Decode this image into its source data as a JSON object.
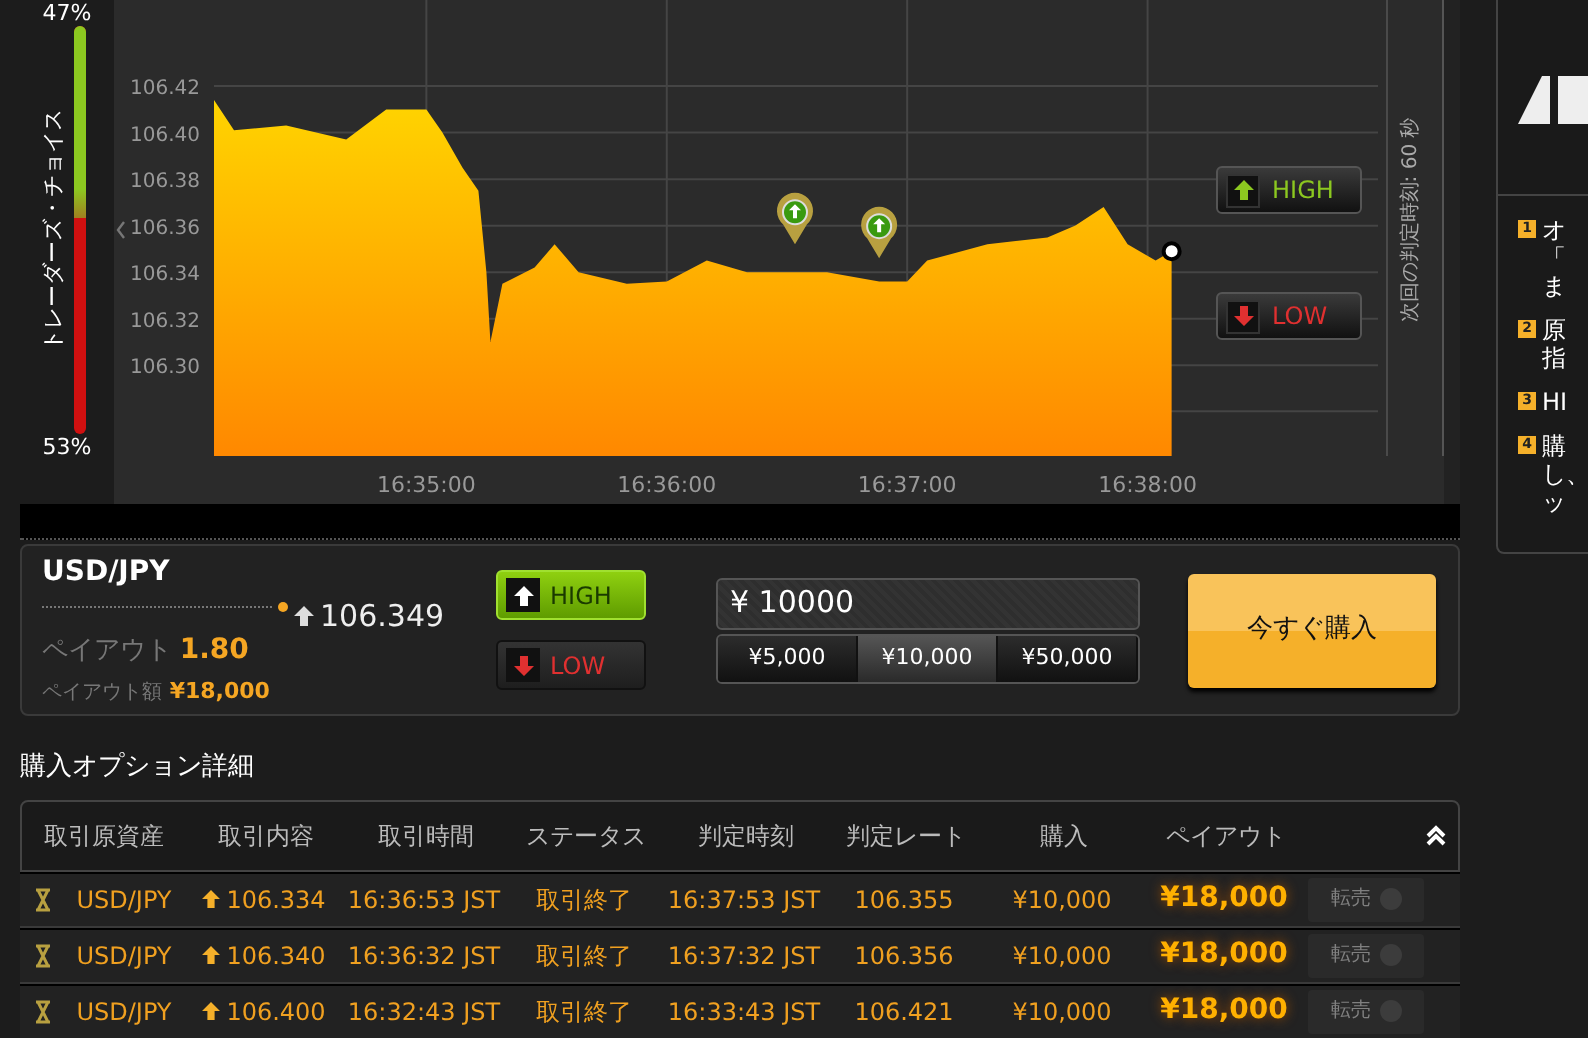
{
  "sentiment": {
    "top_pct": "47%",
    "bottom_pct": "53%",
    "label": "トレーダーズ・チョイス",
    "level": 0.47
  },
  "chart": {
    "next_expiry": "次回の判定時刻: 60 秒",
    "buttons": [
      {
        "label": "HIGH",
        "kind": "high"
      },
      {
        "label": "LOW",
        "kind": "low"
      }
    ],
    "chart_data": {
      "type": "area",
      "grid": true,
      "xlim": [
        59647,
        59939
      ],
      "ylim": [
        106.261,
        106.457
      ],
      "xticks": [
        {
          "value": 59700,
          "label": "16:35:00"
        },
        {
          "value": 59760,
          "label": "16:36:00"
        },
        {
          "value": 59820,
          "label": "16:37:00"
        },
        {
          "value": 59880,
          "label": "16:38:00"
        }
      ],
      "yticks": [
        {
          "value": 106.3,
          "label": "106.30"
        },
        {
          "value": 106.32,
          "label": "106.32"
        },
        {
          "value": 106.34,
          "label": "106.34"
        },
        {
          "value": 106.36,
          "label": "106.36"
        },
        {
          "value": 106.38,
          "label": "106.38"
        },
        {
          "value": 106.4,
          "label": "106.40"
        },
        {
          "value": 106.42,
          "label": "106.42"
        }
      ],
      "x": [
        59647,
        59652,
        59665,
        59680,
        59690,
        59700,
        59704,
        59709,
        59713,
        59715,
        59716,
        59719,
        59727,
        59732,
        59738,
        59750,
        59760,
        59770,
        59780,
        59792,
        59800,
        59813,
        59820,
        59825,
        59840,
        59855,
        59862,
        59869,
        59875,
        59882,
        59886
      ],
      "values": [
        106.414,
        106.401,
        106.403,
        106.397,
        106.41,
        106.41,
        106.4,
        106.385,
        106.375,
        106.34,
        106.31,
        106.335,
        106.342,
        106.352,
        106.34,
        106.335,
        106.336,
        106.345,
        106.34,
        106.34,
        106.34,
        106.336,
        106.336,
        106.345,
        106.352,
        106.355,
        106.36,
        106.368,
        106.352,
        106.345,
        106.349
      ]
    }
  },
  "trade": {
    "asset": "USD/JPY",
    "kind": "high",
    "rate": "106.349",
    "payout_label": "ペイアウト",
    "payout_rate": "1.80",
    "payout_amount_label": "ペイアウト額",
    "payout_amount": "¥18,000",
    "direction_buttons": [
      {
        "label": "HIGH",
        "kind": "high",
        "selected": true
      },
      {
        "label": "LOW",
        "kind": "low",
        "selected": false
      }
    ],
    "amount": {
      "currency": "¥",
      "value": "10000"
    },
    "presets": [
      {
        "label": "¥5,000",
        "selected": false
      },
      {
        "label": "¥10,000",
        "selected": true
      },
      {
        "label": "¥50,000",
        "selected": false
      }
    ],
    "buy_button": "今すぐ購入"
  },
  "details": {
    "title": "購入オプション詳細",
    "columns": [
      "取引原資産",
      "取引内容",
      "取引時間",
      "ステータス",
      "判定時刻",
      "判定レート",
      "購入",
      "ペイアウト"
    ],
    "rows": [
      {
        "asset": "USD/JPY",
        "kind": "high",
        "strike": "106.334",
        "time": "16:36:53 JST",
        "status": "取引終了",
        "expiry": "16:37:53 JST",
        "rate": "106.355",
        "amount": "¥10,000",
        "payout": "¥18,000",
        "sell": {
          "label": "転売",
          "disabled": true
        }
      },
      {
        "asset": "USD/JPY",
        "kind": "high",
        "strike": "106.340",
        "time": "16:36:32 JST",
        "status": "取引終了",
        "expiry": "16:37:32 JST",
        "rate": "106.356",
        "amount": "¥10,000",
        "payout": "¥18,000",
        "sell": {
          "label": "転売",
          "disabled": true
        }
      },
      {
        "asset": "USD/JPY",
        "kind": "high",
        "strike": "106.400",
        "time": "16:32:43 JST",
        "status": "取引終了",
        "expiry": "16:33:43 JST",
        "rate": "106.421",
        "amount": "¥10,000",
        "payout": "¥18,000",
        "sell": {
          "label": "転売",
          "disabled": true
        }
      }
    ]
  },
  "side_panel": {
    "steps": [
      {
        "number": "1",
        "lines": [
          "オ",
          "「",
          "ま"
        ]
      },
      {
        "number": "2",
        "lines": [
          "原",
          "指"
        ]
      },
      {
        "number": "3",
        "lines": [
          "HI"
        ]
      },
      {
        "number": "4",
        "lines": [
          "購",
          "し、",
          "ッ"
        ]
      }
    ]
  }
}
